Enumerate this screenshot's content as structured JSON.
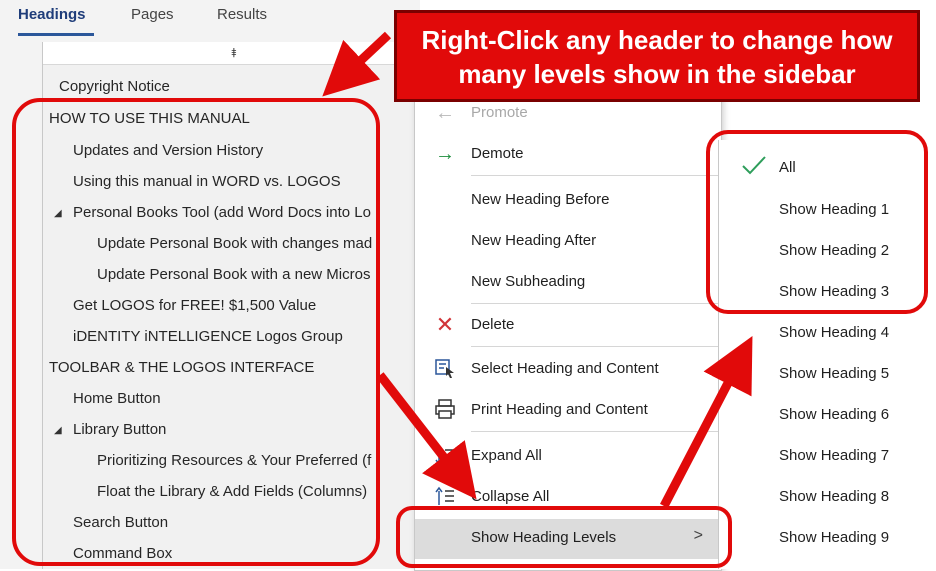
{
  "tabs": [
    {
      "label": "Headings",
      "active": true
    },
    {
      "label": "Pages",
      "active": false
    },
    {
      "label": "Results",
      "active": false
    }
  ],
  "tree": {
    "items": [
      {
        "label": "Copyright Notice",
        "level": 0,
        "expander": false
      },
      {
        "label": "HOW TO USE THIS MANUAL",
        "level": 0,
        "expander": true
      },
      {
        "label": "Updates and Version History",
        "level": 1,
        "expander": false
      },
      {
        "label": "Using this manual in WORD vs. LOGOS",
        "level": 1,
        "expander": false
      },
      {
        "label": "Personal Books Tool (add Word Docs into Lo",
        "level": 1,
        "expander": true
      },
      {
        "label": "Update Personal Book with changes mad",
        "level": 2,
        "expander": false
      },
      {
        "label": "Update Personal Book with a new Micros",
        "level": 2,
        "expander": false
      },
      {
        "label": "Get LOGOS for FREE! $1,500 Value",
        "level": 1,
        "expander": false
      },
      {
        "label": "iDENTITY iNTELLIGENCE Logos Group",
        "level": 1,
        "expander": false
      },
      {
        "label": "TOOLBAR & THE LOGOS INTERFACE",
        "level": 0,
        "expander": true
      },
      {
        "label": "Home Button",
        "level": 1,
        "expander": false
      },
      {
        "label": "Library Button",
        "level": 1,
        "expander": true
      },
      {
        "label": "Prioritizing Resources & Your Preferred (f",
        "level": 2,
        "expander": false
      },
      {
        "label": "Float the Library & Add Fields (Columns)",
        "level": 2,
        "expander": false
      },
      {
        "label": "Search Button",
        "level": 1,
        "expander": false
      },
      {
        "label": "Command Box",
        "level": 1,
        "expander": false
      }
    ]
  },
  "menu": {
    "promote": "Promote",
    "demote": "Demote",
    "new_before": "New Heading Before",
    "new_after": "New Heading After",
    "new_sub": "New Subheading",
    "delete": "Delete",
    "select_content": "Select Heading and Content",
    "print_content": "Print Heading and Content",
    "expand_all": "Expand All",
    "collapse_all": "Collapse All",
    "show_levels": "Show Heading Levels",
    "chevron": ">"
  },
  "submenu": {
    "items": [
      "All",
      "Show Heading 1",
      "Show Heading 2",
      "Show Heading 3",
      "Show Heading 4",
      "Show Heading 5",
      "Show Heading 6",
      "Show Heading 7",
      "Show Heading 8",
      "Show Heading 9"
    ],
    "checked": "All"
  },
  "callout": {
    "line1": "Right-Click any header to change how",
    "line2": "many levels show in the sidebar"
  },
  "colors": {
    "annotation_red": "#e10a0a",
    "demote_arrow": "#1e8e3e",
    "delete_x": "#d13438",
    "check": "#2e9e5b",
    "tab_accent": "#2b579a"
  },
  "icons": {
    "promote": "arrow-left-icon",
    "demote": "arrow-right-icon",
    "delete": "x-icon",
    "select": "select-heading-icon",
    "print": "printer-icon",
    "expand": "expand-all-icon",
    "collapse": "collapse-all-icon",
    "check": "checkmark-icon"
  }
}
